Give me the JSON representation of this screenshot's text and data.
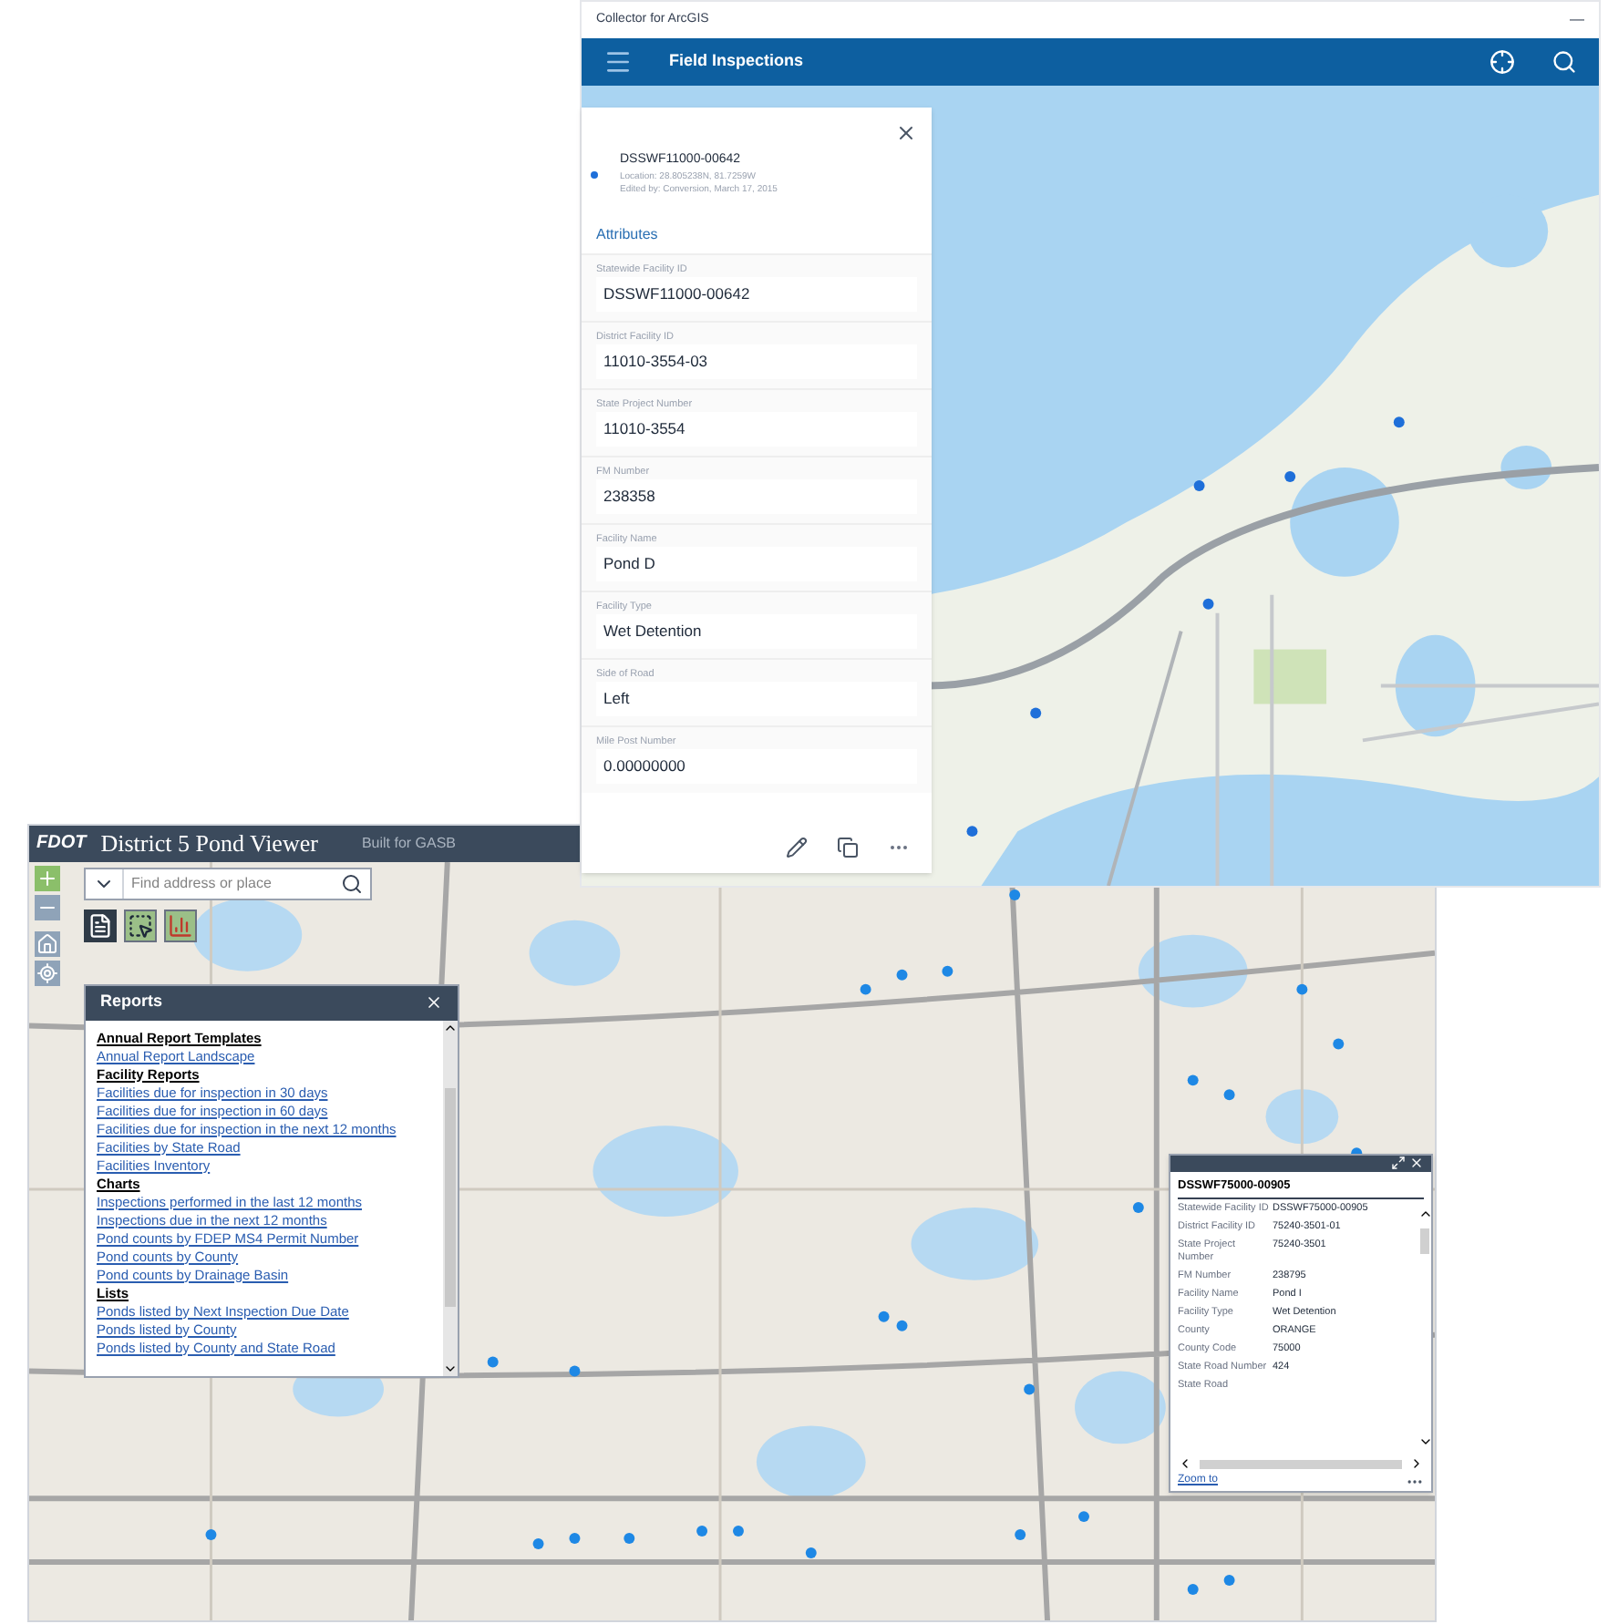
{
  "collector": {
    "window_title": "Collector for ArcGIS",
    "minimize": "—",
    "header_title": "Field Inspections",
    "feature": {
      "title": "DSSWF11000-00642",
      "location": "Location: 28.805238N, 81.7259W",
      "edited": "Edited by: Conversion, March 17, 2015"
    },
    "attributes_heading": "Attributes",
    "attributes": [
      {
        "label": "Statewide Facility ID",
        "value": "DSSWF11000-00642"
      },
      {
        "label": "District Facility ID",
        "value": "11010-3554-03"
      },
      {
        "label": "State Project Number",
        "value": "11010-3554"
      },
      {
        "label": "FM Number",
        "value": "238358"
      },
      {
        "label": "Facility Name",
        "value": "Pond D"
      },
      {
        "label": "Facility Type",
        "value": "Wet Detention"
      },
      {
        "label": "Side of Road",
        "value": "Left"
      },
      {
        "label": "Mile Post Number",
        "value": "0.00000000"
      }
    ]
  },
  "pond_viewer": {
    "logo": "FDOT",
    "title": "District 5 Pond Viewer",
    "subtitle": "Built for GASB",
    "search": {
      "placeholder": "Find address or place"
    },
    "tools": [
      {
        "kind": "report",
        "selected": true
      },
      {
        "kind": "select",
        "selected": false
      },
      {
        "kind": "chart",
        "selected": false
      }
    ],
    "reports_panel": {
      "title": "Reports",
      "items": [
        {
          "kind": "heading",
          "text": "Annual Report Templates"
        },
        {
          "kind": "link",
          "text": "Annual Report Landscape"
        },
        {
          "kind": "heading",
          "text": "Facility Reports"
        },
        {
          "kind": "link",
          "text": "Facilities due for inspection in 30 days"
        },
        {
          "kind": "link",
          "text": "Facilities due for inspection in 60 days"
        },
        {
          "kind": "link",
          "text": "Facilities due for inspection in the next 12 months"
        },
        {
          "kind": "link",
          "text": "Facilities by State Road"
        },
        {
          "kind": "link",
          "text": "Facilities Inventory"
        },
        {
          "kind": "heading",
          "text": "Charts"
        },
        {
          "kind": "link",
          "text": "Inspections performed in the last 12 months"
        },
        {
          "kind": "link",
          "text": "Inspections due in the next 12 months"
        },
        {
          "kind": "link",
          "text": "Pond counts by FDEP MS4 Permit Number"
        },
        {
          "kind": "link",
          "text": "Pond counts by County"
        },
        {
          "kind": "link",
          "text": "Pond counts by Drainage Basin"
        },
        {
          "kind": "heading",
          "text": "Lists"
        },
        {
          "kind": "link",
          "text": "Ponds listed by Next Inspection Due Date"
        },
        {
          "kind": "link",
          "text": "Ponds listed by County"
        },
        {
          "kind": "link",
          "text": "Ponds listed by County and State Road"
        }
      ]
    },
    "popup": {
      "title": "DSSWF75000-00905",
      "rows": [
        {
          "label": "Statewide Facility ID",
          "value": "DSSWF75000-00905"
        },
        {
          "label": "District Facility ID",
          "value": "75240-3501-01"
        },
        {
          "label": "State Project Number",
          "value": "75240-3501"
        },
        {
          "label": "FM Number",
          "value": "238795"
        },
        {
          "label": "Facility Name",
          "value": "Pond I"
        },
        {
          "label": "Facility Type",
          "value": "Wet Detention"
        },
        {
          "label": "County",
          "value": "ORANGE"
        },
        {
          "label": "County Code",
          "value": "75000"
        },
        {
          "label": "State Road Number",
          "value": "424"
        },
        {
          "label": "State Road",
          "value": ""
        }
      ],
      "zoom_link": "Zoom to"
    }
  }
}
